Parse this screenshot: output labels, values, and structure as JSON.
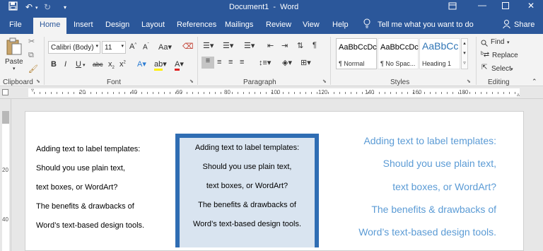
{
  "window": {
    "title": "Document1  -  Word"
  },
  "tabs": [
    "File",
    "Home",
    "Insert",
    "Design",
    "Layout",
    "References",
    "Mailings",
    "Review",
    "View",
    "Help"
  ],
  "tell_me": "Tell me what you want to do",
  "share": "Share",
  "clipboard": {
    "paste": "Paste",
    "label": "Clipboard"
  },
  "font": {
    "name": "Calibri (Body)",
    "size": "11",
    "label": "Font"
  },
  "paragraph": {
    "label": "Paragraph"
  },
  "styles": {
    "label": "Styles",
    "items": [
      {
        "sample": "AaBbCcDc",
        "name": "¶ Normal"
      },
      {
        "sample": "AaBbCcDc",
        "name": "¶ No Spac..."
      },
      {
        "sample": "AaBbCc",
        "name": "Heading 1"
      }
    ]
  },
  "editing": {
    "find": "Find",
    "replace": "Replace",
    "select": "Select",
    "label": "Editing"
  },
  "ruler": {
    "numbers": [
      "20",
      "40",
      "60",
      "80",
      "100",
      "120",
      "140",
      "160",
      "180"
    ]
  },
  "vruler": {
    "numbers": [
      "20",
      "40"
    ]
  },
  "document": {
    "plain": [
      "Adding text to label templates:",
      "Should you use plain text,",
      "text boxes, or WordArt?",
      "The benefits & drawbacks of",
      "Word’s text-based design tools."
    ],
    "textbox": [
      "Adding text to label templates:",
      "Should you use plain text,",
      "text boxes, or WordArt?",
      "The benefits & drawbacks of",
      "Word’s text-based design tools."
    ],
    "wordart": [
      "Adding text to label templates:",
      "Should you use plain text,",
      "text boxes, or WordArt?",
      "The benefits & drawbacks of",
      "Word’s text-based design tools."
    ]
  },
  "colors": {
    "word_blue": "#2b579a",
    "textbox_border": "#2f6db3",
    "textbox_fill": "#d9e4f0",
    "wordart": "#5b9bd5"
  },
  "icons": [
    "save-icon",
    "undo-icon",
    "redo-icon",
    "customize-icon",
    "ribbon-display-icon",
    "minimize-icon",
    "maximize-icon",
    "close-icon",
    "lightbulb-icon",
    "person-icon",
    "paste-icon",
    "cut-icon",
    "copy-icon",
    "format-painter-icon",
    "search-icon",
    "replace-icon",
    "select-icon"
  ]
}
